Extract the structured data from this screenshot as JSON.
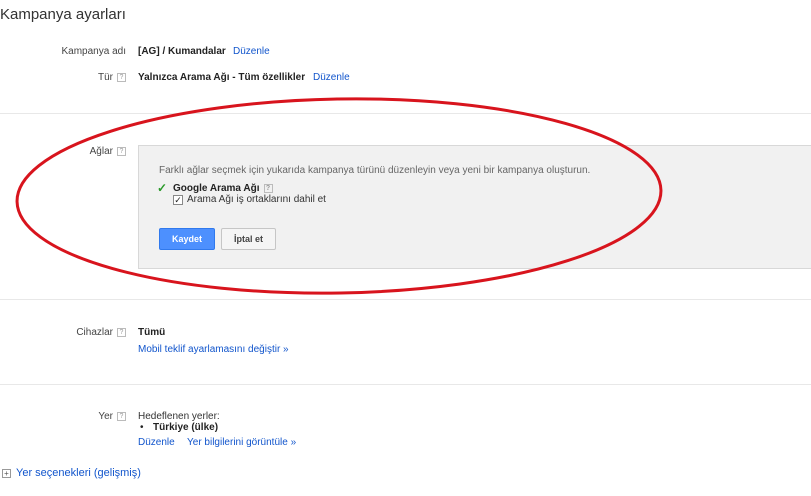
{
  "page": {
    "title": "Kampanya ayarları"
  },
  "campaign_name": {
    "label": "Kampanya adı",
    "value": "[AG] / Kumandalar",
    "edit": "Düzenle"
  },
  "type": {
    "label": "Tür",
    "help": "?",
    "value": "Yalnızca Arama Ağı - Tüm özellikler",
    "edit": "Düzenle"
  },
  "networks": {
    "label": "Ağlar",
    "help": "?",
    "note": "Farklı ağlar seçmek için yukarıda kampanya türünü düzenleyin veya yeni bir kampanya oluşturun.",
    "check_symbol": "✓",
    "network_name": "Google Arama Ağı",
    "network_help": "?",
    "partners_checkbox_mark": "✓",
    "partners_label": "Arama Ağı iş ortaklarını dahil et",
    "save_label": "Kaydet",
    "cancel_label": "İptal et"
  },
  "devices": {
    "label": "Cihazlar",
    "help": "?",
    "value": "Tümü",
    "link": "Mobil teklif ayarlamasını değiştir »"
  },
  "location": {
    "label": "Yer",
    "help": "?",
    "targeted_label": "Hedeflenen yerler:",
    "bullet": "•",
    "targeted_value": "Türkiye (ülke)",
    "edit": "Düzenle",
    "view_link": "Yer bilgilerini görüntüle »"
  },
  "advanced": {
    "expand_symbol": "+",
    "label": "Yer seçenekleri (gelişmiş)"
  },
  "colors": {
    "annotation": "#d8141d",
    "accent_blue": "#4d90fe",
    "link": "#1155cc",
    "check_green": "#2a9a2a"
  }
}
